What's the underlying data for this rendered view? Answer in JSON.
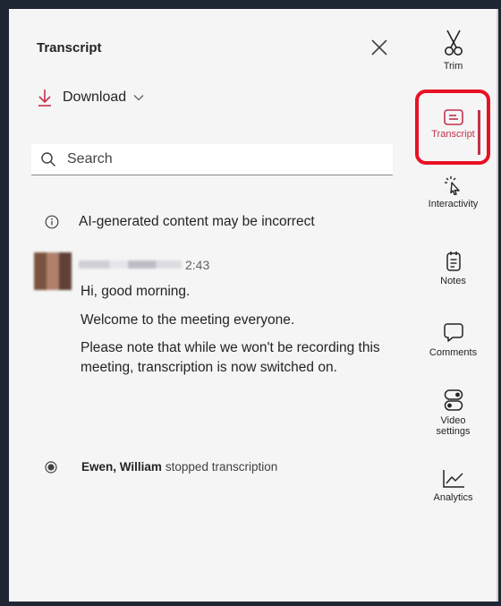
{
  "panel": {
    "title": "Transcript",
    "download_label": "Download",
    "search_placeholder": "Search",
    "ai_note": "AI-generated content may be incorrect"
  },
  "entry": {
    "time": "2:43",
    "lines": [
      "Hi, good morning.",
      "Welcome to the meeting everyone.",
      "Please note that while we won't be recording this meeting, transcription is now switched on."
    ]
  },
  "event": {
    "name": "Ewen, William",
    "text": "stopped transcription"
  },
  "rail": {
    "items": [
      {
        "label": "Trim",
        "icon": "scissors-icon"
      },
      {
        "label": "Transcript",
        "icon": "transcript-icon",
        "active": true
      },
      {
        "label": "Interactivity",
        "icon": "cursor-click-icon"
      },
      {
        "label": "Notes",
        "icon": "notes-icon"
      },
      {
        "label": "Comments",
        "icon": "comment-icon"
      },
      {
        "label": "Video settings",
        "icon": "video-settings-icon"
      },
      {
        "label": "Analytics",
        "icon": "analytics-icon"
      }
    ]
  },
  "colors": {
    "accent": "#c4314b",
    "download_icon": "#c4314b",
    "highlight": "#e81123"
  }
}
